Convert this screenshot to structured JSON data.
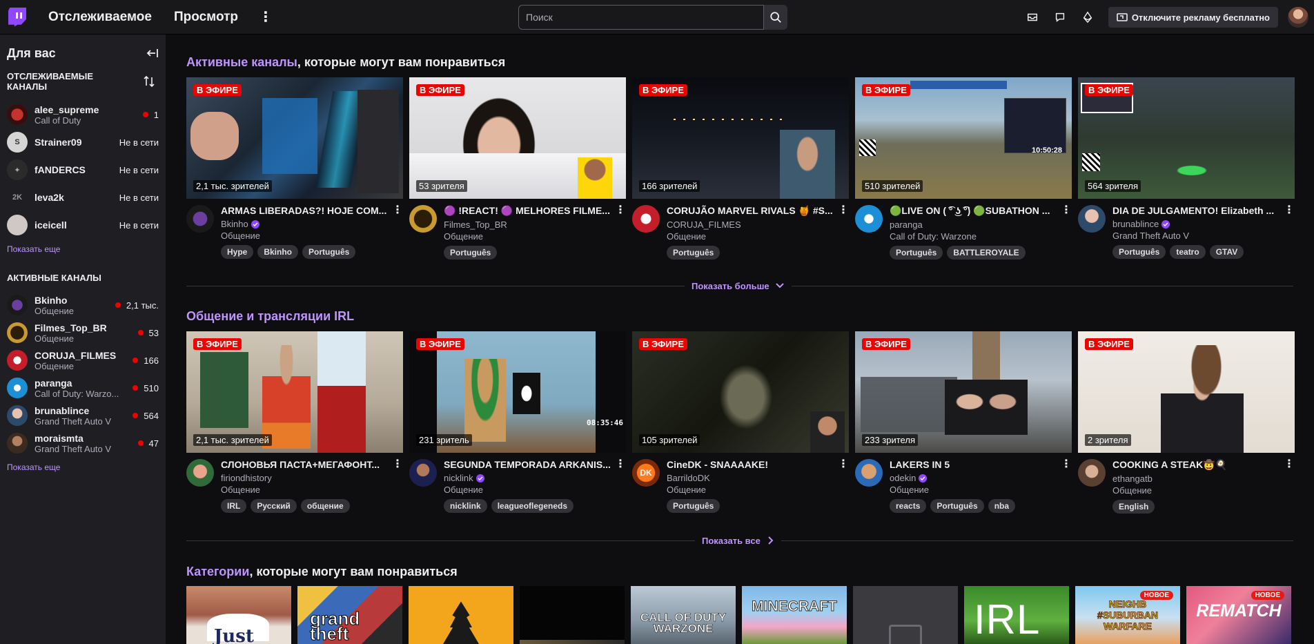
{
  "nav": {
    "following": "Отслеживаемое",
    "browse": "Просмотр",
    "search_placeholder": "Поиск",
    "ads_button": "Отключите рекламу бесплатно"
  },
  "sidebar": {
    "title": "Для вас",
    "followed_header": "ОТСЛЕЖИВАЕМЫЕ КАНАЛЫ",
    "followed": [
      {
        "name": "alee_supreme",
        "game": "Call of Duty",
        "status": "1",
        "live": true
      },
      {
        "name": "Strainer09",
        "game": "",
        "status": "Не в сети",
        "live": false
      },
      {
        "name": "fANDERCS",
        "game": "",
        "status": "Не в сети",
        "live": false
      },
      {
        "name": "leva2k",
        "game": "",
        "status": "Не в сети",
        "live": false
      },
      {
        "name": "iceicell",
        "game": "",
        "status": "Не в сети",
        "live": false
      }
    ],
    "show_more": "Показать еще",
    "live_header": "АКТИВНЫЕ КАНАЛЫ",
    "live": [
      {
        "name": "Bkinho",
        "game": "Общение",
        "status": "2,1 тыс."
      },
      {
        "name": "Filmes_Top_BR",
        "game": "Общение",
        "status": "53"
      },
      {
        "name": "CORUJA_FILMES",
        "game": "Общение",
        "status": "166"
      },
      {
        "name": "paranga",
        "game": "Call of Duty: Warzo...",
        "status": "510"
      },
      {
        "name": "brunablince",
        "game": "Grand Theft Auto V",
        "status": "564"
      },
      {
        "name": "moraismta",
        "game": "Grand Theft Auto V",
        "status": "47"
      }
    ],
    "show_more_2": "Показать еще"
  },
  "section1": {
    "title_hl": "Активные каналы",
    "title_rest": ", которые могут вам понравиться",
    "show_more": "Показать больше",
    "cards": [
      {
        "live": "В ЭФИРЕ",
        "viewers": "2,1 тыс. зрителей",
        "title": "ARMAS LIBERADAS?! HOJE COM...",
        "channel": "Bkinho",
        "category": "Общение",
        "tags": [
          "Hype",
          "Bkinho",
          "Português"
        ]
      },
      {
        "live": "В ЭФИРЕ",
        "viewers": "53 зрителя",
        "title": "🟣 !REACT! 🟣 MELHORES FILME...",
        "channel": "Filmes_Top_BR",
        "category": "Общение",
        "tags": [
          "Português"
        ]
      },
      {
        "live": "В ЭФИРЕ",
        "viewers": "166 зрителей",
        "title": "CORUJÃO MARVEL RIVALS 🍯 #S...",
        "channel": "CORUJA_FILMES",
        "category": "Общение",
        "tags": [
          "Português"
        ]
      },
      {
        "live": "В ЭФИРЕ",
        "viewers": "510 зрителей",
        "title": "🟢LIVE ON ( ͡° ͜ʖ ͡°) 🟢SUBATHON ...",
        "channel": "paranga",
        "category": "Call of Duty: Warzone",
        "tags": [
          "Português",
          "BATTLEROYALE"
        ]
      },
      {
        "live": "В ЭФИРЕ",
        "viewers": "564 зрителя",
        "title": "DIA DE JULGAMENTO! Elizabeth ...",
        "channel": "brunablince",
        "category": "Grand Theft Auto V",
        "tags": [
          "Português",
          "teatro",
          "GTAV"
        ]
      }
    ]
  },
  "section2": {
    "title_hl": "Общение и трансляции IRL",
    "show_all": "Показать все",
    "cards": [
      {
        "live": "В ЭФИРЕ",
        "viewers": "2,1 тыс. зрителей",
        "title": "СЛОНОВЬЯ ПАСТА+МЕГАФОНТ...",
        "channel": "firiondhistory",
        "category": "Общение",
        "tags": [
          "IRL",
          "Русский",
          "общение"
        ]
      },
      {
        "live": "В ЭФИРЕ",
        "viewers": "231 зритель",
        "title": "SEGUNDA TEMPORADA ARKANIS...",
        "channel": "nicklink",
        "category": "Общение",
        "tags": [
          "nicklink",
          "leagueoflegeneds"
        ]
      },
      {
        "live": "В ЭФИРЕ",
        "viewers": "105 зрителей",
        "title": "CineDK - SNAAAAKE!",
        "channel": "BarrildoDK",
        "category": "Общение",
        "tags": [
          "Português"
        ]
      },
      {
        "live": "В ЭФИРЕ",
        "viewers": "233 зрителя",
        "title": "LAKERS IN 5",
        "channel": "odekin",
        "category": "Общение",
        "tags": [
          "reacts",
          "Português",
          "nba"
        ]
      },
      {
        "live": "В ЭФИРЕ",
        "viewers": "2 зрителя",
        "title": "COOKING A STEAK🤠🍳",
        "channel": "ethangatb",
        "category": "Общение",
        "tags": [
          "English"
        ]
      }
    ]
  },
  "section3": {
    "title_hl": "Категории",
    "title_rest": ", которые могут вам понравиться",
    "tiles": [
      {
        "label": "Just",
        "badge": ""
      },
      {
        "label": "grand theft",
        "badge": ""
      },
      {
        "label": "",
        "badge": ""
      },
      {
        "label": "",
        "badge": ""
      },
      {
        "label": "CALL OF DUTY WARZONE",
        "badge": ""
      },
      {
        "label": "MINECRAFT",
        "badge": ""
      },
      {
        "label": "",
        "badge": ""
      },
      {
        "label": "IRL",
        "badge": ""
      },
      {
        "label": "NEIGHB #SUBURBAN WARFARE",
        "badge": "НОВОЕ"
      },
      {
        "label": "REMATCH",
        "badge": "НОВОЕ"
      }
    ]
  },
  "timer_overlay": "08:35:46",
  "colors": {
    "accent": "#9147ff",
    "accent_text": "#bf94ff",
    "live": "#eb0400"
  }
}
